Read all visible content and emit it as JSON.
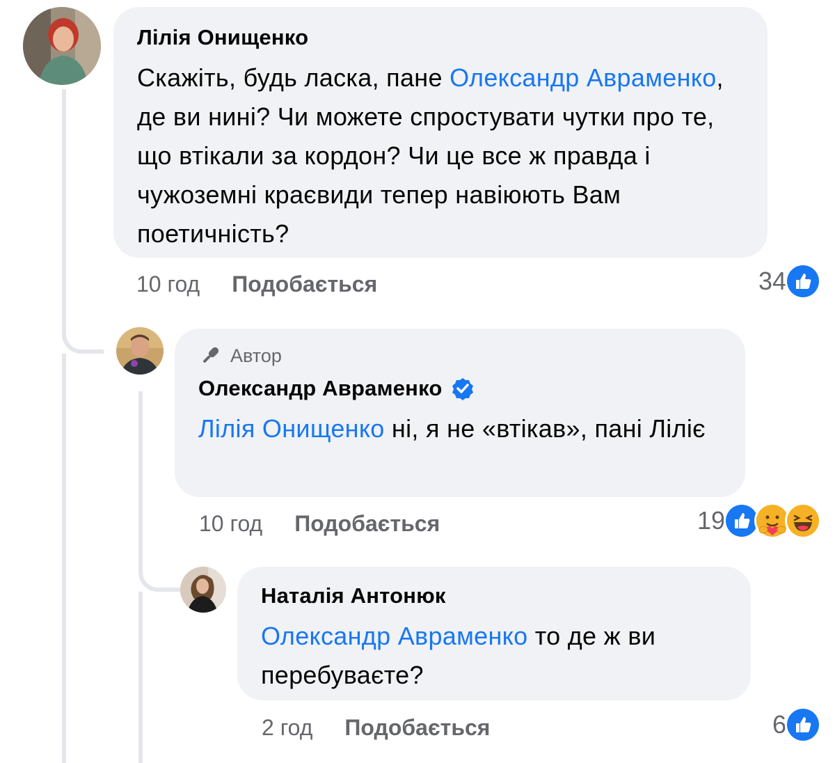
{
  "comments": [
    {
      "author": "Лілія Онищенко",
      "text_parts": [
        {
          "text": "Скажіть, будь ласка, пане ",
          "mention": false
        },
        {
          "text": "Олександр Авраменко",
          "mention": true
        },
        {
          "text": ", де ви нині? Чи можете спростувати чутки про те, що втікали за кордон? Чи це все ж правда і чужоземні краєвиди тепер навіюють Вам поетичність?",
          "mention": false
        }
      ],
      "time": "10 год",
      "like_label": "Подобається",
      "reaction_count": "34",
      "reactions": [
        "like-icon"
      ]
    },
    {
      "badge": "Автор",
      "author": "Олександр Авраменко",
      "verified": true,
      "text_parts": [
        {
          "text": "Лілія Онищенко",
          "mention": true
        },
        {
          "text": " ні, я не «втікав», пані Ліліє",
          "mention": false
        }
      ],
      "time": "10 год",
      "like_label": "Подобається",
      "reaction_count": "19",
      "reactions": [
        "like-icon",
        "care-icon",
        "haha-icon"
      ]
    },
    {
      "author": "Наталія Антонюк",
      "text_parts": [
        {
          "text": "Олександр Авраменко",
          "mention": true
        },
        {
          "text": " то де ж ви перебуваєте?",
          "mention": false
        }
      ],
      "time": "2 год",
      "like_label": "Подобається",
      "reaction_count": "6",
      "reactions": [
        "like-icon"
      ]
    }
  ],
  "colors": {
    "mention": "#1877f2",
    "bubble": "#f0f2f5",
    "meta": "#65676b",
    "like_blue": "#1877f2"
  }
}
